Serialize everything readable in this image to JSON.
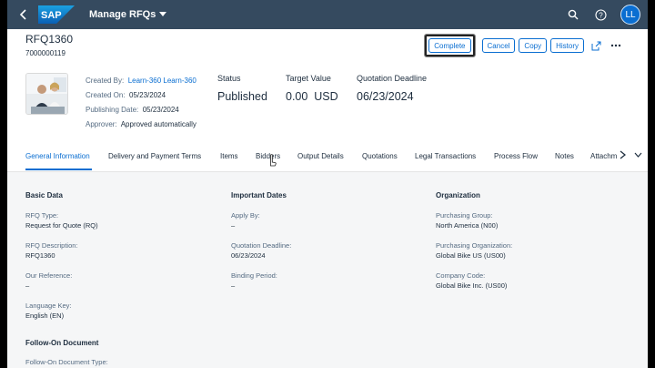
{
  "shell": {
    "app_title": "Manage RFQs",
    "avatar_initials": "LL",
    "brand_color": "#354a5f",
    "accent": "#0a6ed1"
  },
  "header": {
    "title": "RFQ1360",
    "subtitle": "7000000119",
    "actions": {
      "complete": "Complete",
      "cancel": "Cancel",
      "copy": "Copy",
      "history": "History"
    },
    "facts": {
      "created_by_label": "Created By:",
      "created_by_value": "Learn-360 Learn-360",
      "created_on_label": "Created On:",
      "created_on_value": "05/23/2024",
      "publishing_label": "Publishing Date:",
      "publishing_value": "05/23/2024",
      "approver_label": "Approver:",
      "approver_value": "Approved automatically"
    },
    "kpis": {
      "status_label": "Status",
      "status_value": "Published",
      "target_label": "Target Value",
      "target_value": "0.00  USD",
      "deadline_label": "Quotation Deadline",
      "deadline_value": "06/23/2024"
    }
  },
  "tabs": [
    "General Information",
    "Delivery and Payment Terms",
    "Items",
    "Bidders",
    "Output Details",
    "Quotations",
    "Legal Transactions",
    "Process Flow",
    "Notes",
    "Attachm"
  ],
  "sections": {
    "basic": {
      "title": "Basic Data",
      "rfq_type_label": "RFQ Type:",
      "rfq_type_value": "Request for Quote (RQ)",
      "rfq_desc_label": "RFQ Description:",
      "rfq_desc_value": "RFQ1360",
      "our_ref_label": "Our Reference:",
      "our_ref_value": "–",
      "lang_label": "Language Key:",
      "lang_value": "English (EN)"
    },
    "dates": {
      "title": "Important Dates",
      "apply_label": "Apply By:",
      "apply_value": "–",
      "deadline_label": "Quotation Deadline:",
      "deadline_value": "06/23/2024",
      "binding_label": "Binding Period:",
      "binding_value": "–"
    },
    "org": {
      "title": "Organization",
      "pgroup_label": "Purchasing Group:",
      "pgroup_value": "North America (N00)",
      "porg_label": "Purchasing Organization:",
      "porg_value": "Global Bike US (US00)",
      "company_label": "Company Code:",
      "company_value": "Global Bike Inc. (US00)"
    },
    "follow_on": {
      "title": "Follow-On Document",
      "type_label": "Follow-On Document Type:"
    }
  }
}
